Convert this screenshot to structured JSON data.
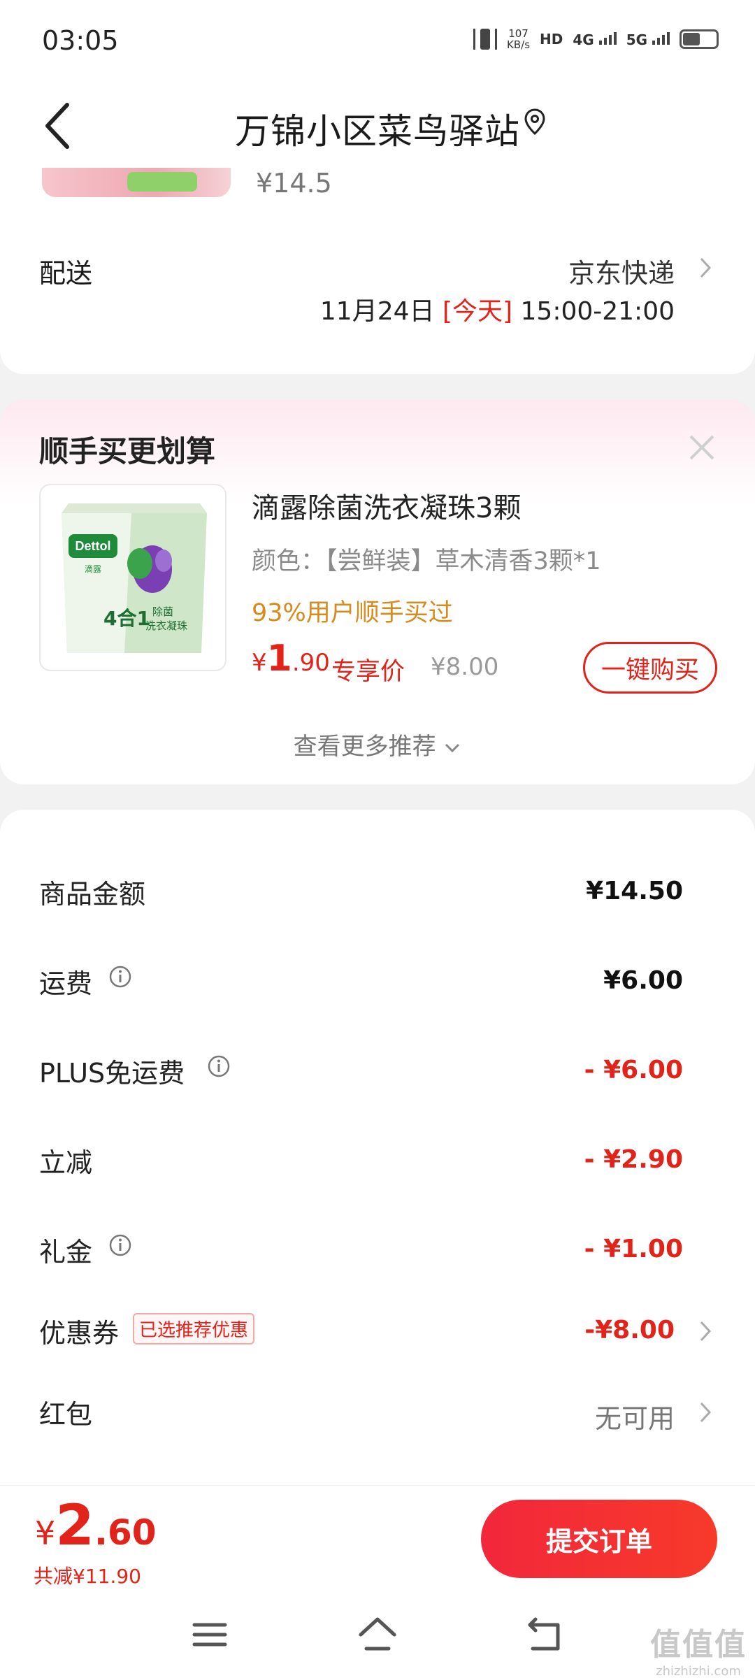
{
  "status_bar": {
    "time": "03:05",
    "net_speed_value": "107",
    "net_speed_unit": "KB/s",
    "hd_label": "HD",
    "sim1": "4G",
    "sim2": "5G"
  },
  "header": {
    "title": "万锦小区菜鸟驿站",
    "back_icon": "chevron-left-icon",
    "location_icon": "location-pin-icon"
  },
  "order_item": {
    "price": "¥14.5"
  },
  "delivery": {
    "label": "配送",
    "carrier": "京东快递",
    "date": "11月24日",
    "day_tag": "[今天]",
    "time_window": "15:00-21:00"
  },
  "recommendation": {
    "title": "顺手买更划算",
    "product_name": "滴露除菌洗衣凝珠3颗",
    "spec": "颜色：【尝鲜装】草木清香3颗*1",
    "social_proof": "93%用户顺手买过",
    "price_symbol": "¥",
    "price_int": "1",
    "price_dec": ".90",
    "exclusive_label": "专享价",
    "original_price": "¥8.00",
    "buy_button": "一键购买",
    "more_link": "查看更多推荐",
    "image_brand": "Dettol",
    "image_brand_cn": "滴露",
    "image_badge": "4合1",
    "image_text1": "除菌",
    "image_text2": "洗衣凝珠"
  },
  "summary": {
    "rows": [
      {
        "label": "商品金额",
        "value": "¥14.50"
      },
      {
        "label": "运费",
        "value": "¥6.00"
      },
      {
        "label": "PLUS免运费",
        "value": "- ¥6.00"
      },
      {
        "label": "立减",
        "value": "- ¥2.90"
      },
      {
        "label": "礼金",
        "value": "- ¥1.00"
      },
      {
        "label": "优惠券",
        "value": "-¥8.00",
        "badge": "已选推荐优惠"
      },
      {
        "label": "红包",
        "value": "无可用"
      }
    ]
  },
  "bottom_bar": {
    "total_symbol": "¥",
    "total_int": "2",
    "total_dec": ".60",
    "saved": "共减¥11.90",
    "submit": "提交订单"
  },
  "watermark": {
    "main": "值值值",
    "sub": "zhizhizhi.com"
  },
  "colors": {
    "accent_red": "#e2231a",
    "orange": "#d98a1c",
    "bg": "#f2f2f2"
  }
}
